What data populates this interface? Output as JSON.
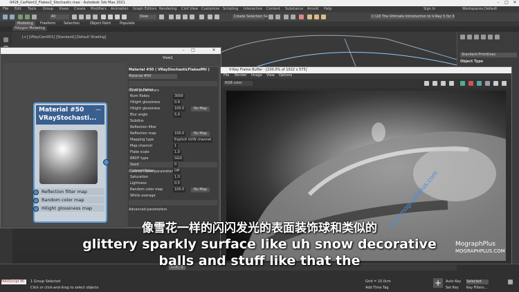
{
  "window": {
    "title": "0418_CarPaint2_Flakes2_Stochastic.max - Autodesk 3ds Max 2021",
    "min": "–",
    "max": "□",
    "close": "✕"
  },
  "menu": [
    "File",
    "Edit",
    "Tools",
    "Group",
    "Views",
    "Create",
    "Modifiers",
    "Animation",
    "Graph Editors",
    "Rendering",
    "Civil View",
    "Customize",
    "Scripting",
    "Interactive",
    "Content",
    "Substance",
    "Arnold",
    "Help"
  ],
  "signin": "Sign In",
  "workspaces_label": "Workspaces:",
  "workspace": "Default",
  "path": "C:\\18 The Ultimate Introduction to V-Ray 5 for 3ds Max\\Project Files",
  "create_selection": "Create Selection Se",
  "view_dropdown": "View",
  "all_dropdown": "All",
  "ribbon_tabs": [
    "Modeling",
    "Freeform",
    "Selection",
    "Object Paint",
    "Populate"
  ],
  "ribbon_sub": "Polygon Modeling",
  "viewport_label": "[+] [VRayCam001] [Standard] [Default Shading]",
  "material_editor": {
    "title": "Material #50 ( VRayStochasticFlakesMtl )",
    "view": "View1",
    "mat_name": "Material #50",
    "node_title": "Material #50",
    "node_sub": "VRayStochasti...",
    "slots": [
      "Reflection filter map",
      "Random color map",
      "Hilight glossiness map"
    ],
    "sections": [
      "Basic parameters",
      "Colored flakes parameters",
      "Advanced parameters"
    ],
    "basic": [
      {
        "label": "Enable flakes",
        "value": ""
      },
      {
        "label": "Num flakes",
        "value": "3000"
      },
      {
        "label": "Hilight glossiness",
        "value": "0.9"
      },
      {
        "label": "Hilight glossiness",
        "value": "100.0",
        "map": "No Map"
      },
      {
        "label": "Blur angle",
        "value": "5.0"
      },
      {
        "label": "Subdivs",
        "value": ""
      },
      {
        "label": "Reflection filter",
        "value": ""
      },
      {
        "label": "Reflection map",
        "value": "100.0",
        "map": "No Map"
      },
      {
        "label": "Mapping type",
        "value": "Explicit UVW channel"
      },
      {
        "label": "Map channel",
        "value": "1"
      },
      {
        "label": "Flake scale",
        "value": "1.0"
      },
      {
        "label": "BRDF type",
        "value": "GGX"
      },
      {
        "label": "Seed",
        "value": "0"
      }
    ],
    "colored": [
      {
        "label": "Colored flakes",
        "value": "Off"
      },
      {
        "label": "Saturation",
        "value": "1.0"
      },
      {
        "label": "Lightness",
        "value": "0.5"
      },
      {
        "label": "Random color map",
        "value": "100.0",
        "map": "No Map"
      },
      {
        "label": "White average",
        "value": ""
      }
    ]
  },
  "vfb": {
    "title": "V-Ray Frame Buffer - [100.0% of 1022 x 575]",
    "menu": [
      "File",
      "Render",
      "Image",
      "View",
      "Options"
    ],
    "channel": "RGB color"
  },
  "right_panel": {
    "primitives": "Standard Primitives",
    "object_type": "Object Type"
  },
  "status": {
    "selected": "1 Group Selected",
    "hint": "Click or click-and-drag to select objects",
    "maxscript": "MAXScript Mi",
    "frame": "176 / 1",
    "grid": "Grid = 10.0cm",
    "addtime": "Add Time Tag",
    "autokey": "Auto Key",
    "setkey": "Set Key",
    "selected_drop": "Selected",
    "keyfilters": "Key Filters..."
  },
  "subtitle": {
    "zh": "像雪花一样的闪闪发光的表面装饰球和类似的",
    "en1": "glittery sparkly surface like uh snow decorative",
    "en2": "balls and stuff like that the"
  },
  "watermark": {
    "brand": "MographPlus",
    "url": "MOGRAPHPLUS.COM",
    "diag": "www.mographplus.com"
  }
}
